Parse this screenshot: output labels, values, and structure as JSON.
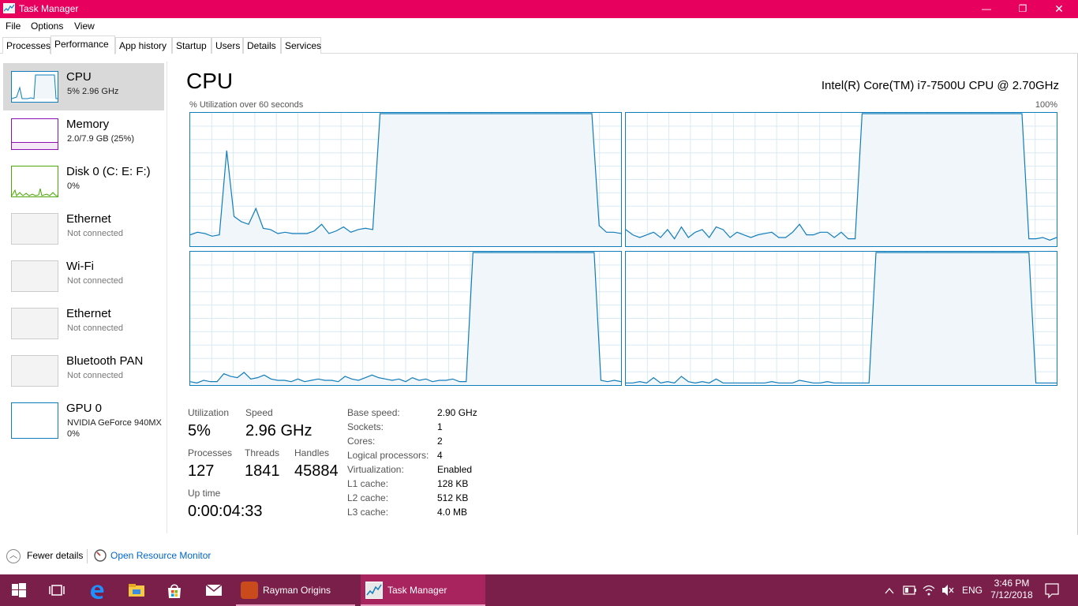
{
  "window": {
    "title": "Task Manager",
    "minimize_glyph": "—",
    "maximize_glyph": "❐",
    "close_glyph": "✕"
  },
  "menu": [
    "File",
    "Options",
    "View"
  ],
  "tabs": [
    {
      "label": "Processes"
    },
    {
      "label": "Performance",
      "active": true
    },
    {
      "label": "App history"
    },
    {
      "label": "Startup"
    },
    {
      "label": "Users"
    },
    {
      "label": "Details"
    },
    {
      "label": "Services"
    }
  ],
  "sidebar": [
    {
      "name": "CPU",
      "sub": "5%  2.96 GHz",
      "color": "#117dbb",
      "selected": true
    },
    {
      "name": "Memory",
      "sub": "2.0/7.9 GB (25%)",
      "color": "#8b12ae"
    },
    {
      "name": "Disk 0 (C: E: F:)",
      "sub": "0%",
      "color": "#4da60c"
    },
    {
      "name": "Ethernet",
      "sub": "Not connected",
      "color": "#cccccc"
    },
    {
      "name": "Wi-Fi",
      "sub": "Not connected",
      "color": "#cccccc"
    },
    {
      "name": "Ethernet",
      "sub": "Not connected",
      "color": "#cccccc"
    },
    {
      "name": "Bluetooth PAN",
      "sub": "Not connected",
      "color": "#cccccc"
    },
    {
      "name": "GPU 0",
      "sub": "NVIDIA GeForce 940MX",
      "sub2": "0%",
      "color": "#117dbb"
    }
  ],
  "main": {
    "title": "CPU",
    "model": "Intel(R) Core(TM) i7-7500U CPU @ 2.70GHz",
    "graph_label": "% Utilization over 60 seconds",
    "graph_max": "100%",
    "graph_color": "#117dbb",
    "graph_fill": "#f1f6fa"
  },
  "cores": [
    [
      8,
      10,
      9,
      7,
      8,
      72,
      22,
      18,
      16,
      28,
      13,
      12,
      9,
      10,
      9,
      9,
      9,
      11,
      16,
      9,
      11,
      14,
      10,
      12,
      13,
      12,
      110,
      110,
      110,
      110,
      110,
      110,
      110,
      110,
      110,
      110,
      110,
      110,
      110,
      110,
      110,
      110,
      110,
      110,
      110,
      110,
      110,
      110,
      110,
      110,
      110,
      110,
      110,
      110,
      110,
      110,
      15,
      10,
      10,
      9
    ],
    [
      12,
      8,
      6,
      8,
      10,
      6,
      12,
      5,
      14,
      6,
      10,
      12,
      6,
      14,
      12,
      6,
      10,
      8,
      6,
      8,
      9,
      10,
      6,
      6,
      10,
      16,
      8,
      8,
      10,
      10,
      6,
      10,
      5,
      5,
      110,
      110,
      110,
      110,
      110,
      110,
      110,
      110,
      110,
      110,
      110,
      110,
      110,
      110,
      110,
      110,
      110,
      110,
      110,
      110,
      110,
      110,
      110,
      110,
      5,
      5,
      6,
      4,
      6
    ],
    [
      2,
      1,
      3,
      2,
      2,
      8,
      6,
      5,
      9,
      4,
      5,
      7,
      4,
      3,
      3,
      2,
      4,
      2,
      3,
      4,
      3,
      3,
      2,
      6,
      4,
      3,
      5,
      7,
      5,
      4,
      3,
      4,
      2,
      5,
      3,
      4,
      2,
      3,
      3,
      4,
      2,
      2,
      130,
      130,
      130,
      130,
      130,
      130,
      130,
      130,
      130,
      130,
      130,
      130,
      130,
      130,
      130,
      130,
      130,
      130,
      130,
      3,
      2,
      3,
      2
    ],
    [
      1,
      1,
      2,
      1,
      5,
      1,
      2,
      1,
      6,
      2,
      1,
      2,
      1,
      4,
      1,
      1,
      1,
      1,
      1,
      1,
      1,
      2,
      1,
      1,
      1,
      3,
      2,
      1,
      1,
      2,
      1,
      1,
      1,
      1,
      1,
      1,
      130,
      130,
      130,
      130,
      130,
      130,
      130,
      130,
      130,
      130,
      130,
      130,
      130,
      130,
      130,
      130,
      130,
      130,
      130,
      130,
      130,
      130,
      130,
      1,
      1,
      1,
      1
    ]
  ],
  "stats": {
    "utilization_label": "Utilization",
    "utilization": "5%",
    "speed_label": "Speed",
    "speed": "2.96 GHz",
    "processes_label": "Processes",
    "processes": "127",
    "threads_label": "Threads",
    "threads": "1841",
    "handles_label": "Handles",
    "handles": "45884",
    "uptime_label": "Up time",
    "uptime": "0:00:04:33"
  },
  "specs": [
    {
      "key": "Base speed:",
      "val": "2.90 GHz"
    },
    {
      "key": "Sockets:",
      "val": "1"
    },
    {
      "key": "Cores:",
      "val": "2"
    },
    {
      "key": "Logical processors:",
      "val": "4"
    },
    {
      "key": "Virtualization:",
      "val": "Enabled",
      "bold": true
    },
    {
      "key": "L1 cache:",
      "val": "128 KB"
    },
    {
      "key": "L2 cache:",
      "val": "512 KB"
    },
    {
      "key": "L3 cache:",
      "val": "4.0 MB"
    }
  ],
  "footer": {
    "fewer_details": "Fewer details",
    "open_resource_monitor": "Open Resource Monitor"
  },
  "taskbar": {
    "apps": [
      {
        "label": "Rayman Origins"
      },
      {
        "label": "Task Manager",
        "active": true
      }
    ],
    "lang": "ENG",
    "time": "3:46 PM",
    "date": "7/12/2018"
  }
}
